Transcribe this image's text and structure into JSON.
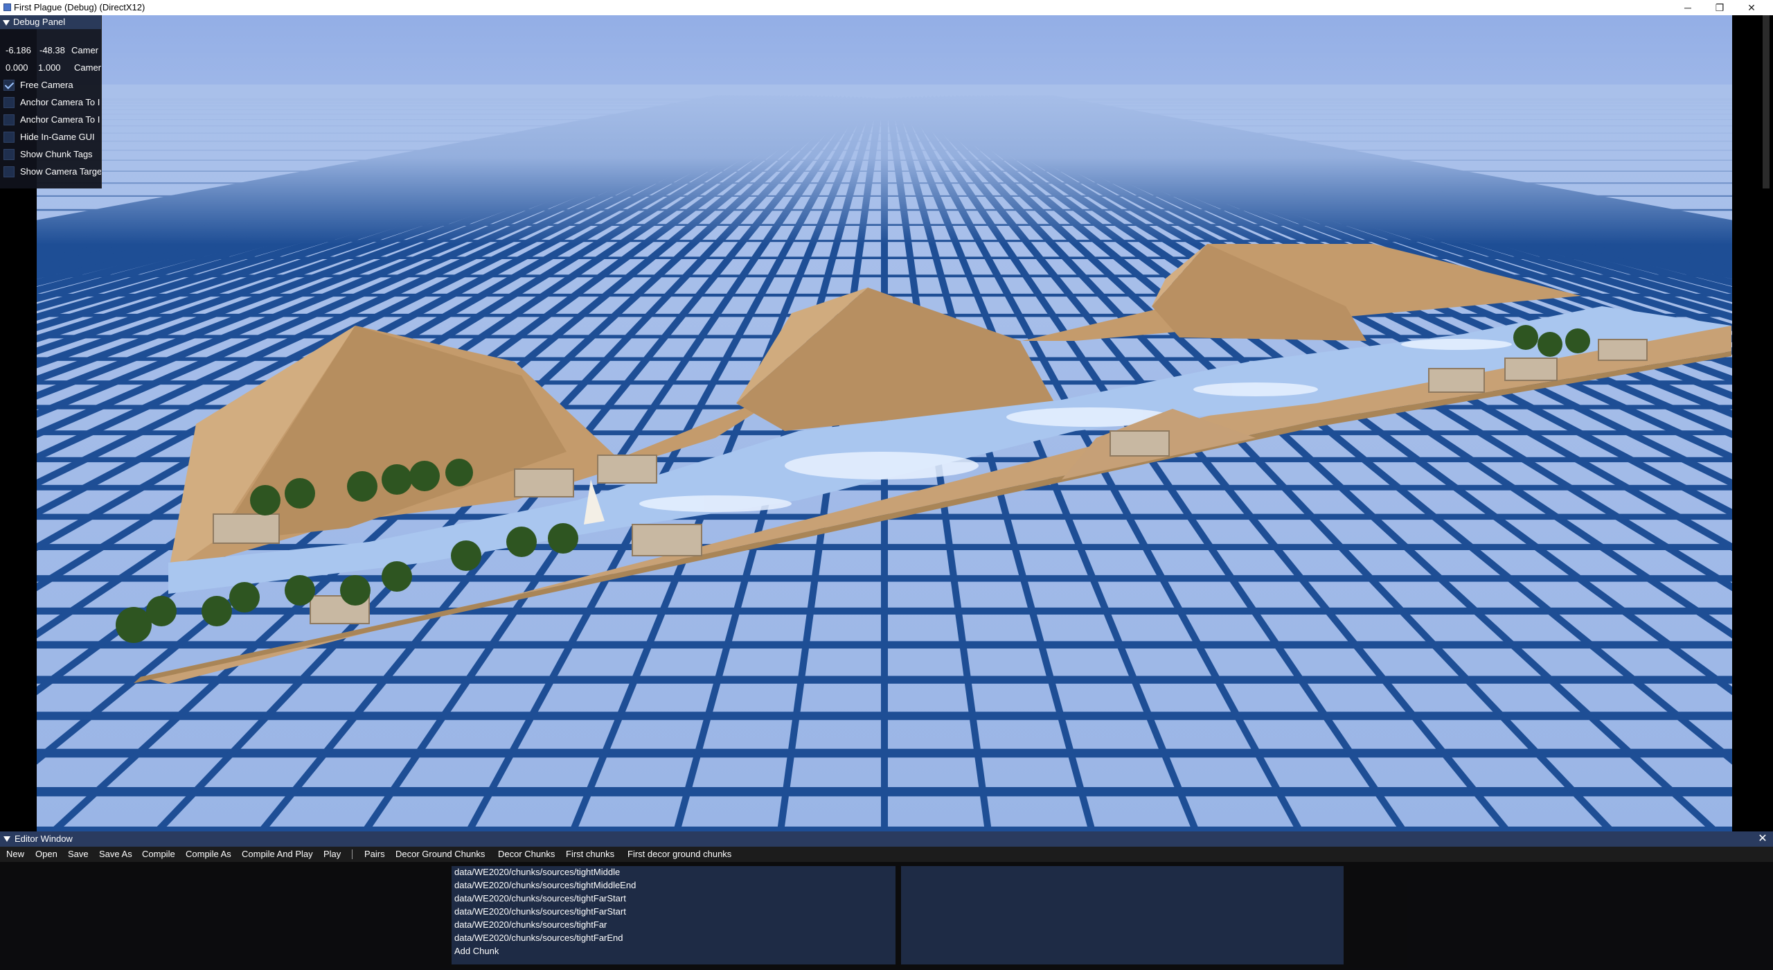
{
  "window": {
    "title": "First Plague (Debug) (DirectX12)",
    "minimize_glyph": "─",
    "maximize_glyph": "❐",
    "close_glyph": "✕"
  },
  "debug_panel": {
    "title": "Debug Panel",
    "row1": {
      "v1": "-6.186",
      "v2": "-48.38",
      "label": "Camer"
    },
    "row2": {
      "v1": "0.000",
      "v2": "1.000",
      "label": "Camer"
    },
    "checkboxes": [
      {
        "label": "Free Camera",
        "checked": true
      },
      {
        "label": "Anchor Camera To I",
        "checked": false
      },
      {
        "label": "Anchor Camera To I",
        "checked": false
      },
      {
        "label": "Hide In-Game GUI",
        "checked": false
      },
      {
        "label": "Show Chunk Tags",
        "checked": false
      },
      {
        "label": "Show Camera Targe",
        "checked": false
      }
    ]
  },
  "editor": {
    "title": "Editor Window",
    "close_glyph": "✕",
    "menu": [
      "New",
      "Open",
      "Save",
      "Save As",
      "Compile",
      "Compile As",
      "Compile And Play",
      "Play",
      "Pairs",
      "Decor Ground Chunks",
      "Decor Chunks",
      "First chunks",
      "First decor ground chunks"
    ],
    "chunks": [
      "data/WE2020/chunks/sources/tightMiddle",
      "data/WE2020/chunks/sources/tightMiddleEnd",
      "data/WE2020/chunks/sources/tightFarStart",
      "data/WE2020/chunks/sources/tightFarStart",
      "data/WE2020/chunks/sources/tightFar",
      "data/WE2020/chunks/sources/tightFarEnd",
      "Add Chunk"
    ]
  },
  "colors": {
    "sky": "#9ab2e4",
    "grid_line": "#1e4e95",
    "sand": "#c9a47a",
    "water": "#a7c5ee",
    "palm": "#2f5a1f"
  }
}
